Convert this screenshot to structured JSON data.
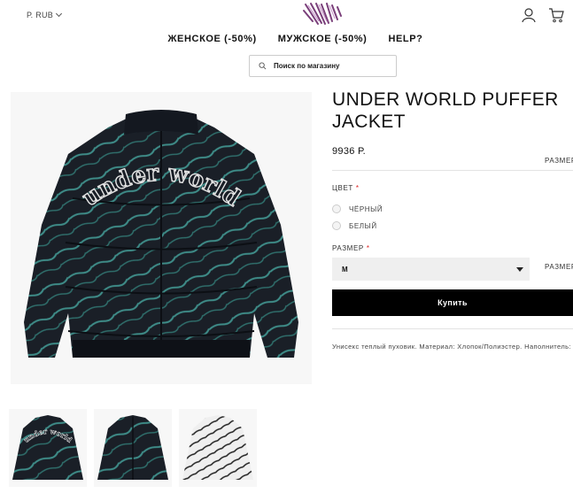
{
  "header": {
    "currency": "Р. RUB",
    "nav": [
      "ЖЕНСКОЕ (-50%)",
      "МУЖСКОЕ (-50%)",
      "HELP?"
    ],
    "search_placeholder": "Поиск по магазину"
  },
  "product": {
    "title": "UNDER WORLD PUFFER JACKET",
    "price": "9936 Р.",
    "size_guide_label": "РАЗМЕРЫ",
    "color_label": "ЦВЕТ",
    "required_mark": "*",
    "color_options": [
      "ЧЁРНЫЙ",
      "БЕЛЫЙ"
    ],
    "size_label": "РАЗМЕР",
    "size_selected": "M",
    "buy_label": "Купить",
    "description": "Унисекс теплый пуховик. Материал: Хлопок/Полиэстер. Наполнитель: пух"
  },
  "colors": {
    "jacket": "#1a1f27",
    "stripe": "#3e8c88",
    "button": "#000000",
    "required": "#dd2222"
  }
}
